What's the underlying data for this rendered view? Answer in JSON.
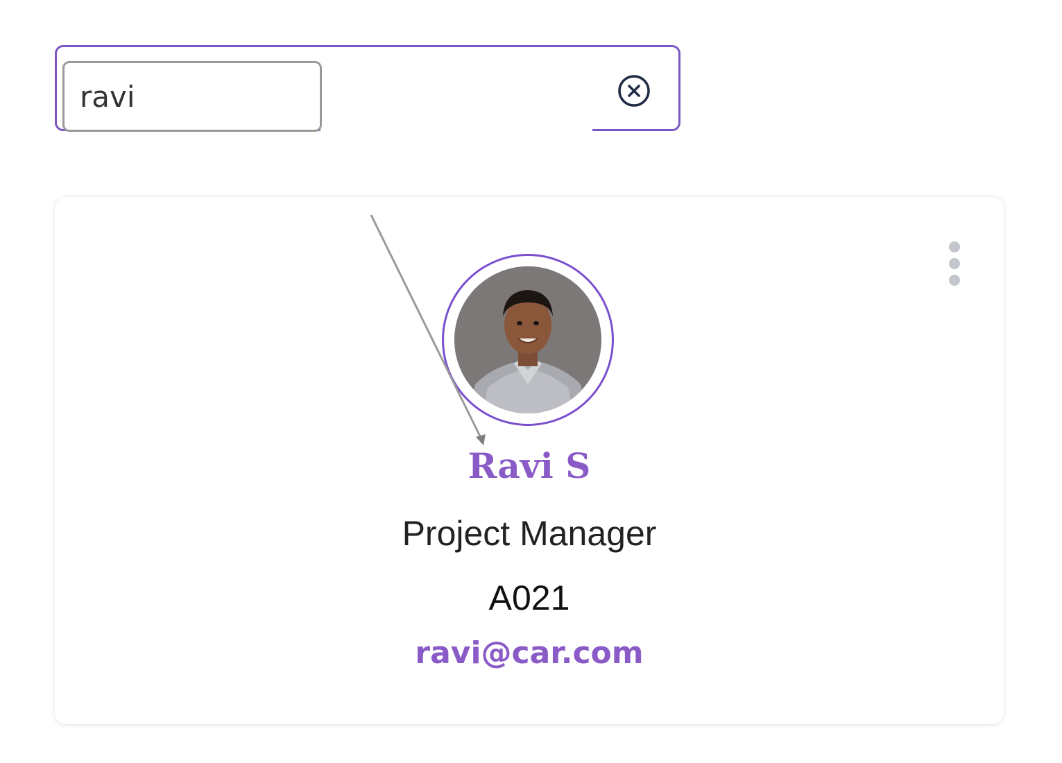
{
  "search": {
    "value": "ravi",
    "clear_icon": "circle-x-icon"
  },
  "employee_card": {
    "menu_icon": "kebab-menu-icon",
    "avatar_icon": "profile-photo",
    "name": "Ravi S",
    "role": "Project Manager",
    "employee_id": "A021",
    "email": "ravi@car.com"
  },
  "colors": {
    "accent": "#7a4fd0",
    "name_text": "#8a5bc7",
    "spellcheck_underline": "#e8323c"
  }
}
